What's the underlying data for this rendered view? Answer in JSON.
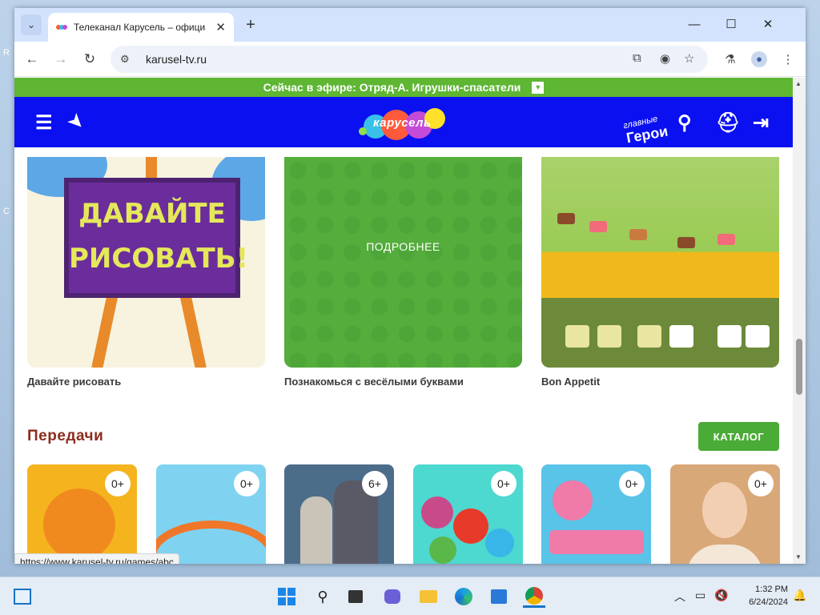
{
  "desktop": {
    "stubs": [
      "R",
      "C"
    ]
  },
  "browser": {
    "tab_list_icon": "chevron-down-icon",
    "tab": {
      "title": "Телеканал Карусель – официа",
      "close": "✕",
      "favicon": "karusel-favicon"
    },
    "new_tab": "+",
    "window_controls": {
      "minimize": "—",
      "maximize": "☐",
      "close": "✕"
    },
    "nav": {
      "back": "←",
      "forward": "→",
      "reload": "↻"
    },
    "omnibox": {
      "url": "karusel-tv.ru",
      "site_info_icon": "tune-icon"
    },
    "toolbar_icons": [
      "install-icon",
      "eye-off-icon",
      "star-icon",
      "flask-icon",
      "profile-icon",
      "kebab-menu-icon"
    ]
  },
  "page": {
    "on_air": {
      "text": "Сейчас в эфире: Отряд-А. Игрушки-спасатели",
      "toggle": "▼"
    },
    "header": {
      "logo_text": "карусель",
      "heroes_small": "главные",
      "heroes_big": "Герои",
      "icons": [
        "menu-icon",
        "location-icon",
        "search-icon",
        "robot-icon",
        "login-icon"
      ]
    },
    "games": [
      {
        "title": "Давайте рисовать",
        "art_line1": "ДАВАЙТЕ",
        "art_line2": "РИСОВАТЬ!"
      },
      {
        "title": "Познакомься с весёлыми буквами",
        "overlay": "ПОДРОБНЕЕ"
      },
      {
        "title": "Bon Appetit"
      }
    ],
    "shows_section": {
      "title": "Передачи",
      "catalog_button": "КАТАЛОГ"
    },
    "shows": [
      {
        "age": "0+",
        "color": "#f5b41e"
      },
      {
        "age": "0+",
        "color": "#7fd3f0"
      },
      {
        "age": "6+",
        "color": "#4c6d8a"
      },
      {
        "age": "0+",
        "color": "#4dd8d0"
      },
      {
        "age": "0+",
        "color": "#59c4e8"
      },
      {
        "age": "0+",
        "color": "#d9a878"
      }
    ],
    "status_url": "https://www.karusel-tv.ru/games/abc"
  },
  "taskbar": {
    "time": "1:32 PM",
    "date": "6/24/2024",
    "icons": [
      "widgets-icon",
      "start-icon",
      "search-icon",
      "task-view-icon",
      "chat-icon",
      "file-explorer-icon",
      "edge-icon",
      "store-icon",
      "chrome-icon"
    ],
    "tray_icons": [
      "chevron-up-icon",
      "network-icon",
      "volume-icon",
      "notification-icon"
    ]
  },
  "colors": {
    "green": "#5eb633",
    "header_blue": "#0b10f0",
    "section_title": "#8b2d1e"
  }
}
